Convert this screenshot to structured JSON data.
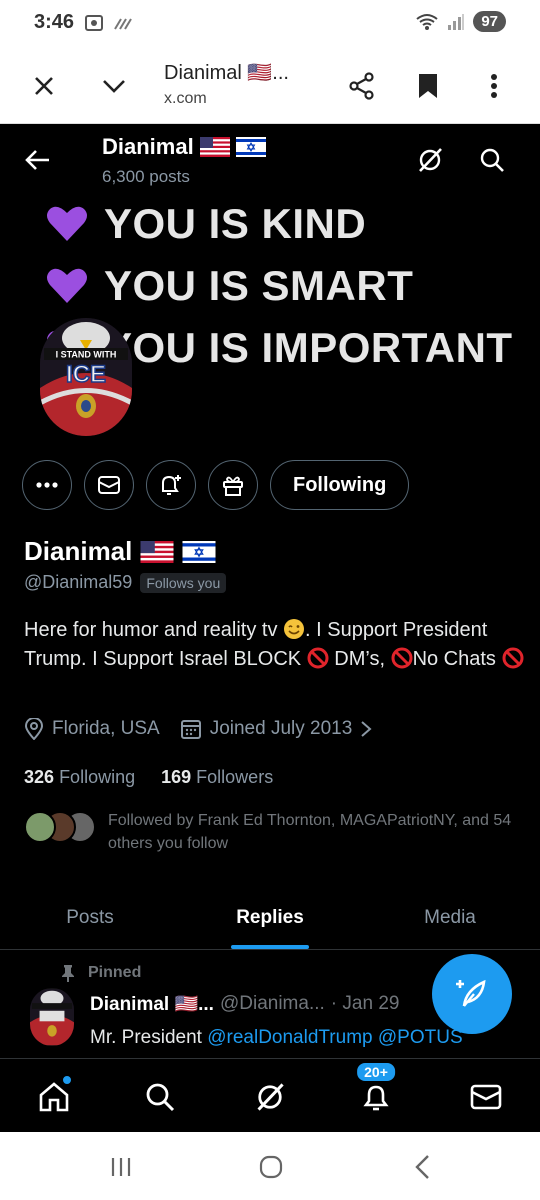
{
  "status_bar": {
    "time": "3:46",
    "battery": "97"
  },
  "browser": {
    "title": "Dianimal 🇺🇸...",
    "url": "x.com"
  },
  "nav": {
    "name": "Dianimal",
    "posts_count": "6,300 posts"
  },
  "banner": {
    "line1": "YOU IS KIND",
    "line2": "YOU IS SMART",
    "line3": "YOU IS IMPORTANT"
  },
  "avatar": {
    "caption_top": "I STAND WITH",
    "caption_big": "ICE"
  },
  "actions": {
    "following_label": "Following"
  },
  "profile": {
    "name": "Dianimal",
    "handle": "@Dianimal59",
    "follows_you": "Follows you",
    "bio_part1": "Here for humor and reality tv ",
    "bio_part2": ". I Support President Trump. I Support Israel BLOCK ",
    "bio_part3": " DM’s, ",
    "bio_part4": "No Chats ",
    "location": "Florida, USA",
    "joined": "Joined July 2013",
    "following_count": "326",
    "following_label": "Following",
    "followers_count": "169",
    "followers_label": "Followers",
    "followed_by": "Followed by Frank Ed Thornton, MAGAPatriotNY, and 54 others you follow"
  },
  "tabs": [
    {
      "label": "Posts"
    },
    {
      "label": "Replies"
    },
    {
      "label": "Media"
    }
  ],
  "post": {
    "pinned_label": "Pinned",
    "name": "Dianimal 🇺🇸...",
    "handle": "@Dianima...",
    "date": "· Jan 29",
    "text_prefix": "Mr. President ",
    "mention1": "@realDonaldTrump",
    "mention2": "@POTUS"
  },
  "bottom_nav": {
    "notif_badge": "20+"
  },
  "colors": {
    "accent": "#1d9bf0",
    "background": "#000000",
    "muted": "#71767b"
  }
}
